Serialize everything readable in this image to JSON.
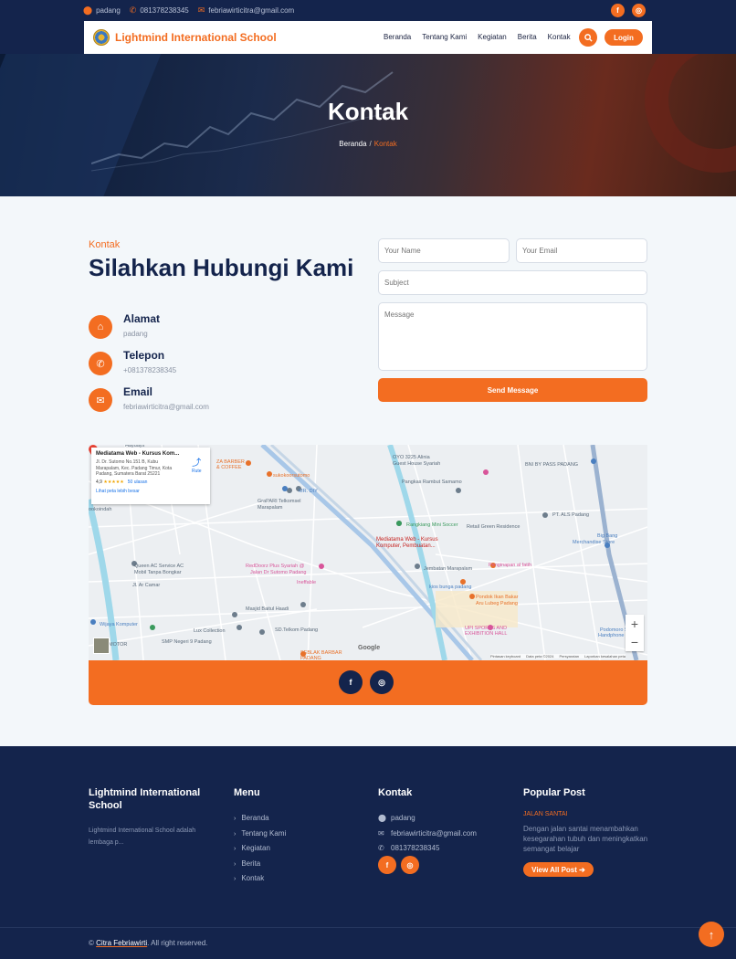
{
  "topbar": {
    "location": "padang",
    "phone": "081378238345",
    "email": "febriawirticitra@gmail.com",
    "social": [
      "f",
      "◎"
    ]
  },
  "nav": {
    "brand": "Lightmind International School",
    "items": [
      "Beranda",
      "Tentang Kami",
      "Kegiatan",
      "Berita",
      "Kontak"
    ],
    "login": "Login"
  },
  "hero": {
    "title": "Kontak",
    "breadcrumb_home": "Beranda",
    "breadcrumb_sep": "/",
    "breadcrumb_current": "Kontak"
  },
  "contact": {
    "kicker": "Kontak",
    "heading": "Silahkan Hubungi Kami",
    "items": [
      {
        "title": "Alamat",
        "value": "padang",
        "icon": "home-icon"
      },
      {
        "title": "Telepon",
        "value": "+081378238345",
        "icon": "phone-icon"
      },
      {
        "title": "Email",
        "value": "febriawirticitra@gmail.com",
        "icon": "envelope-icon"
      }
    ]
  },
  "form": {
    "name_placeholder": "Your Name",
    "email_placeholder": "Your Email",
    "subject_placeholder": "Subject",
    "message_placeholder": "Message",
    "send": "Send Message"
  },
  "map": {
    "place_name": "Mediatama Web - Kursus Kom...",
    "address": "Jl. Dr. Sutomo No.151 B, Kubu Marapalam, Kec. Padang Timur, Kota Padang, Sumatera Barat 25221",
    "rating": "4,9",
    "stars": "★★★★★",
    "reviews": "50 ulasan",
    "larger_map": "Lihat peta lebih besar",
    "directions": "Rute",
    "pin_label": "Mediatama Web - Kursus Komputer, Pembuatan...",
    "labels": [
      "OYO 3225 Alinia Guest House Syariah",
      "Pangkas Rambut Samamo",
      "BNI BY PASS PADANG",
      "MR. DIY",
      "GraPARI Telkomsel Marapalam",
      "Rangkiang Mini Soccer",
      "Retail Green Residence",
      "PT. ALS Padang",
      "Big Bang Merchandise Store",
      "Queen AC Service AC Mobil Tanpa Bongkar",
      "RedDoorz Plus Syariah @ Jalan Dr Sutomo Padang",
      "Ineffable",
      "Jembatan Marapalam",
      "Penginapan al fatih",
      "kios bunga padang",
      "Pondok Ikan Bakar Aru Lubeg Padang",
      "UPI SPORTS AND EXHIBITION HALL",
      "Masjid Baitul Haadi",
      "Lux Collection",
      "SD.Telkom Padang",
      "SMP Negeri 9 Padang",
      "Wijaya Komputer",
      "SEBLAK BARBAR PADANG",
      "Podomoro Service Handphone (Apple)",
      "sukokoorsutomo",
      "ZA BARBER & COFFEE",
      "Haydays",
      "ookoindah",
      "Jl. Ar Camar",
      "MOTOR"
    ],
    "footer": [
      "Pintasan keyboard",
      "Data peta ©2024",
      "Persyaratan",
      "Laporkan kesalahan peta"
    ],
    "google": "Google"
  },
  "social_bar": [
    "f",
    "◎"
  ],
  "footer": {
    "about_title": "Lightmind International School",
    "about_text": "Lightmind International School adalah lembaga p...",
    "menu_title": "Menu",
    "menu_items": [
      "Beranda",
      "Tentang Kami",
      "Kegiatan",
      "Berita",
      "Kontak"
    ],
    "contact_title": "Kontak",
    "contact_location": "padang",
    "contact_email": "febriawirticitra@gmail.com",
    "contact_phone": "081378238345",
    "popular_title": "Popular Post",
    "post_tag": "JALAN SANTAI",
    "post_text": "Dengan jalan santai menambahkan kesegarahan tubuh dan meningkatkan semangat belajar",
    "view_all": "View All Post",
    "copyright_name": "Citra Febriawirti",
    "copyright_rest": ". All right reserved."
  },
  "colors": {
    "accent": "#f36d21",
    "navy": "#14244c"
  }
}
